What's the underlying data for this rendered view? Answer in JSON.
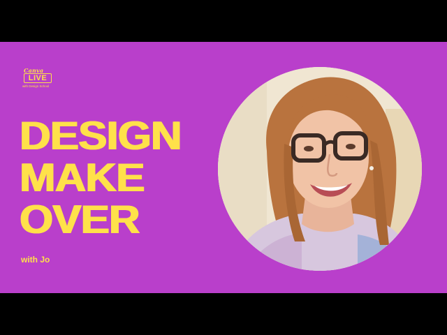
{
  "logo": {
    "brand": "Canva",
    "badge": "LIVE",
    "subtitle": "with Design School"
  },
  "title": {
    "line1": "DESIGN",
    "line2": "MAKE",
    "line3": "OVER"
  },
  "host": "with Jo",
  "colors": {
    "background": "#B93FCB",
    "accent": "#FFE14A",
    "letterbox": "#000000"
  },
  "portrait": {
    "icon": "host-photo"
  }
}
